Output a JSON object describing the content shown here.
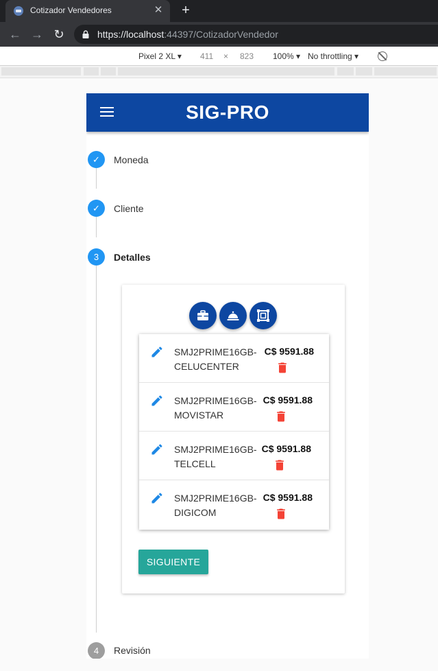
{
  "browser": {
    "tab_title": "Cotizador Vendedores",
    "tab_close": "✕",
    "new_tab": "+",
    "url_scheme": "https://",
    "url_host": "localhost",
    "url_rest": ":44397/CotizadorVendedor"
  },
  "device_toolbar": {
    "device": "Pixel 2 XL ▾",
    "width": "411",
    "times": "×",
    "height": "823",
    "zoom": "100% ▾",
    "throttling": "No throttling ▾"
  },
  "app": {
    "brand": "SIG-PRO",
    "header_color": "#0d47a1",
    "accent_color": "#2196f3"
  },
  "steps": [
    {
      "number": "✓",
      "label": "Moneda",
      "state": "done"
    },
    {
      "number": "✓",
      "label": "Cliente",
      "state": "done"
    },
    {
      "number": "3",
      "label": "Detalles",
      "state": "active"
    },
    {
      "number": "4",
      "label": "Revisión",
      "state": "pending"
    }
  ],
  "actions": [
    {
      "icon": "briefcase-icon"
    },
    {
      "icon": "service-bell-icon"
    },
    {
      "icon": "crop-frame-icon"
    }
  ],
  "items": [
    {
      "product_line1": "SMJ2PRIME16GB-",
      "product_line2": "CELUCENTER",
      "price": "C$ 9591.88"
    },
    {
      "product_line1": "SMJ2PRIME16GB-",
      "product_line2": "MOVISTAR",
      "price": "C$ 9591.88"
    },
    {
      "product_line1": "SMJ2PRIME16GB-",
      "product_line2": "TELCELL",
      "price": "C$ 9591.88"
    },
    {
      "product_line1": "SMJ2PRIME16GB-",
      "product_line2": "DIGICOM",
      "price": "C$ 9591.88"
    }
  ],
  "next_button": "SIGUIENTE",
  "colors": {
    "edit": "#1e88e5",
    "delete": "#f44336",
    "next_button": "#26a69a"
  }
}
